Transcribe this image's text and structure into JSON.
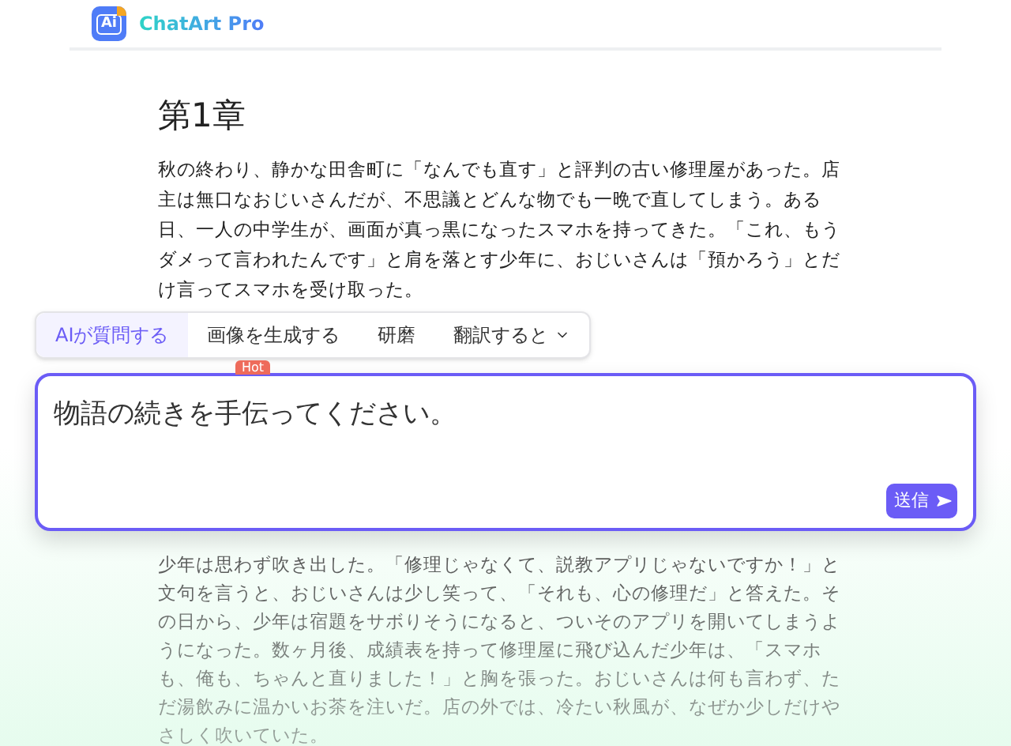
{
  "header": {
    "logo_text": "Ai",
    "brand": "ChatArt Pro"
  },
  "chapter_title": "第1章",
  "paragraph_1": "秋の終わり、静かな田舎町に「なんでも直す」と評判の古い修理屋があった。店主は無口なおじいさんだが、不思議とどんな物でも一晩で直してしまう。ある日、一人の中学生が、画面が真っ黒になったスマホを持ってきた。「これ、もうダメって言われたんです」と肩を落とす少年に、おじいさんは「預かろう」とだけ言ってスマホを受け取った。",
  "toolbar": [
    {
      "label": "AIが質問する",
      "selected": true,
      "dropdown": false
    },
    {
      "label": "画像を生成する",
      "selected": false,
      "dropdown": false
    },
    {
      "label": "研磨",
      "selected": false,
      "dropdown": false
    },
    {
      "label": "翻訳すると",
      "selected": false,
      "dropdown": true
    }
  ],
  "hot_badge": "Hot",
  "prompt": {
    "value": "物語の続きを手伝ってください。",
    "send_label": "送信"
  },
  "paragraph_2": "少年は思わず吹き出した。「修理じゃなくて、説教アプリじゃないですか！」と文句を言うと、おじいさんは少し笑って、「それも、心の修理だ」と答えた。その日から、少年は宿題をサボりそうになると、ついそのアプリを開いてしまうようになった。数ヶ月後、成績表を持って修理屋に飛び込んだ少年は、「スマホも、俺も、ちゃんと直りました！」と胸を張った。おじいさんは何も言わず、ただ湯飲みに温かいお茶を注いだ。店の外では、冷たい秋風が、なぜか少しだけやさしく吹いていた。"
}
